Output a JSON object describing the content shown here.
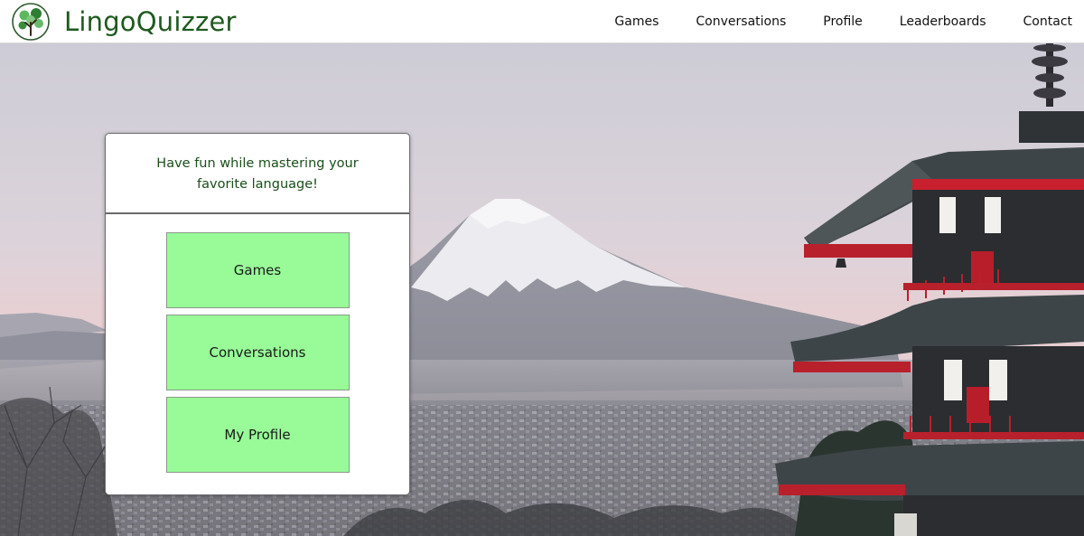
{
  "brand": {
    "name": "LingoQuizzer",
    "logo_icon": "tree-logo-icon"
  },
  "nav": {
    "items": [
      {
        "label": "Games"
      },
      {
        "label": "Conversations"
      },
      {
        "label": "Profile"
      },
      {
        "label": "Leaderboards"
      },
      {
        "label": "Contact"
      }
    ]
  },
  "hero": {
    "image_subject": "mount-fuji-pagoda-photo"
  },
  "card": {
    "tagline": "Have fun while mastering your favorite language!",
    "buttons": [
      {
        "label": "Games"
      },
      {
        "label": "Conversations"
      },
      {
        "label": "My Profile"
      }
    ]
  },
  "colors": {
    "brand_green": "#1e5a1e",
    "button_green": "#98fb98",
    "pagoda_red": "#b8202c"
  }
}
